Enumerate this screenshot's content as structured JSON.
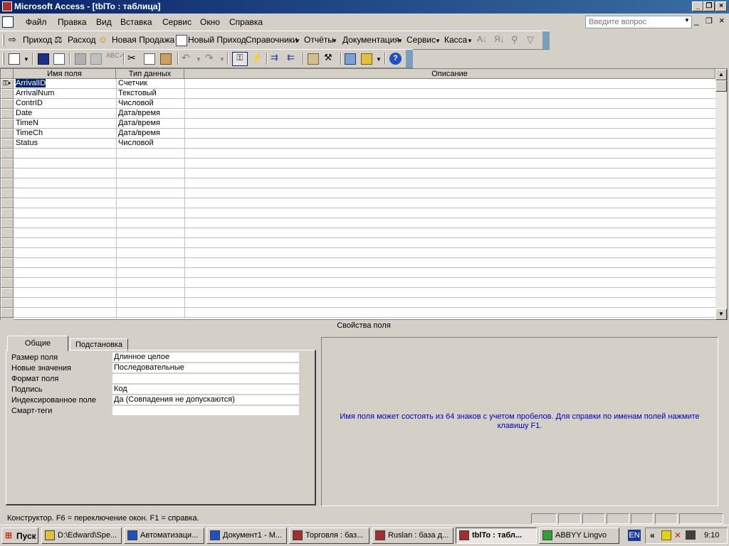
{
  "window": {
    "title": "Microsoft Access - [tblTo : таблица]",
    "ask_placeholder": "Введите вопрос"
  },
  "menu": [
    "Файл",
    "Правка",
    "Вид",
    "Вставка",
    "Сервис",
    "Окно",
    "Справка"
  ],
  "custom_toolbar": {
    "items": [
      "Приход",
      "Расход",
      "Новая Продажа",
      "Новый Приход",
      "Справочники",
      "Отчёты",
      "Документация",
      "Сервис",
      "Касса"
    ]
  },
  "grid": {
    "headers": [
      "Имя поля",
      "Тип данных",
      "Описание"
    ],
    "rows": [
      {
        "name": "ArrivalID",
        "type": "Счетчик"
      },
      {
        "name": "ArrivalNum",
        "type": "Текстовый"
      },
      {
        "name": "ContrID",
        "type": "Числовой"
      },
      {
        "name": "Date",
        "type": "Дата/время"
      },
      {
        "name": "TimeN",
        "type": "Дата/время"
      },
      {
        "name": "TimeCh",
        "type": "Дата/время"
      },
      {
        "name": "Status",
        "type": "Числовой"
      }
    ]
  },
  "properties": {
    "title": "Свойства поля",
    "tabs": [
      "Общие",
      "Подстановка"
    ],
    "fields": [
      {
        "label": "Размер поля",
        "value": "Длинное целое"
      },
      {
        "label": "Новые значения",
        "value": "Последовательные"
      },
      {
        "label": "Формат поля",
        "value": ""
      },
      {
        "label": "Подпись",
        "value": "Код"
      },
      {
        "label": "Индексированное поле",
        "value": "Да (Совпадения не допускаются)"
      },
      {
        "label": "Смарт-теги",
        "value": ""
      }
    ],
    "help_text": "Имя поля может состоять из 64 знаков с учетом пробелов.  Для справки по именам полей нажмите клавишу F1."
  },
  "status": {
    "text": "Конструктор.  F6 = переключение окон.  F1 = справка."
  },
  "taskbar": {
    "start": "Пуск",
    "tasks": [
      "D:\\Edward\\Spe...",
      "Автоматизаци...",
      "Документ1 - М...",
      "Торговля : баз...",
      "Ruslan : база д...",
      "tblTo : табл...",
      "ABBYY Lingvo"
    ],
    "active_index": 5,
    "lang": "EN",
    "clock": "9:10"
  }
}
